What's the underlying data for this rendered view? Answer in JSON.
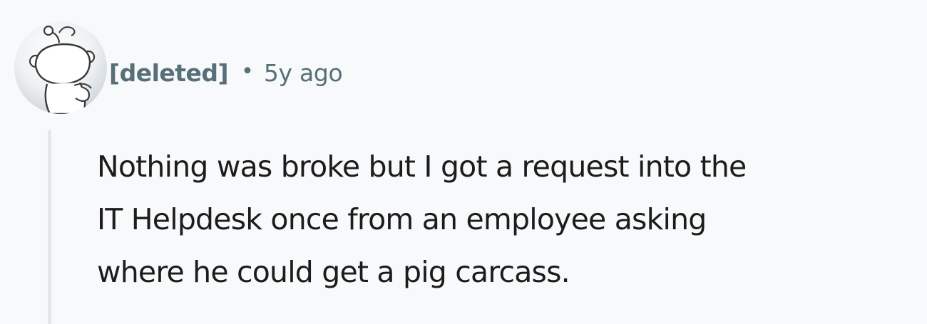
{
  "comment": {
    "author": "[deleted]",
    "separator": "•",
    "timestamp": "5y ago",
    "avatar_icon": "snoo-avatar-icon",
    "body_lines": [
      "Nothing was broke but I got a request into the",
      "IT Helpdesk once from an employee asking",
      "where he could get a pig carcass."
    ]
  },
  "colors": {
    "background": "#f7f9fa",
    "meta_text": "#576f76",
    "body_text": "#1c1c1c",
    "thread_line": "#e2e7e9"
  }
}
